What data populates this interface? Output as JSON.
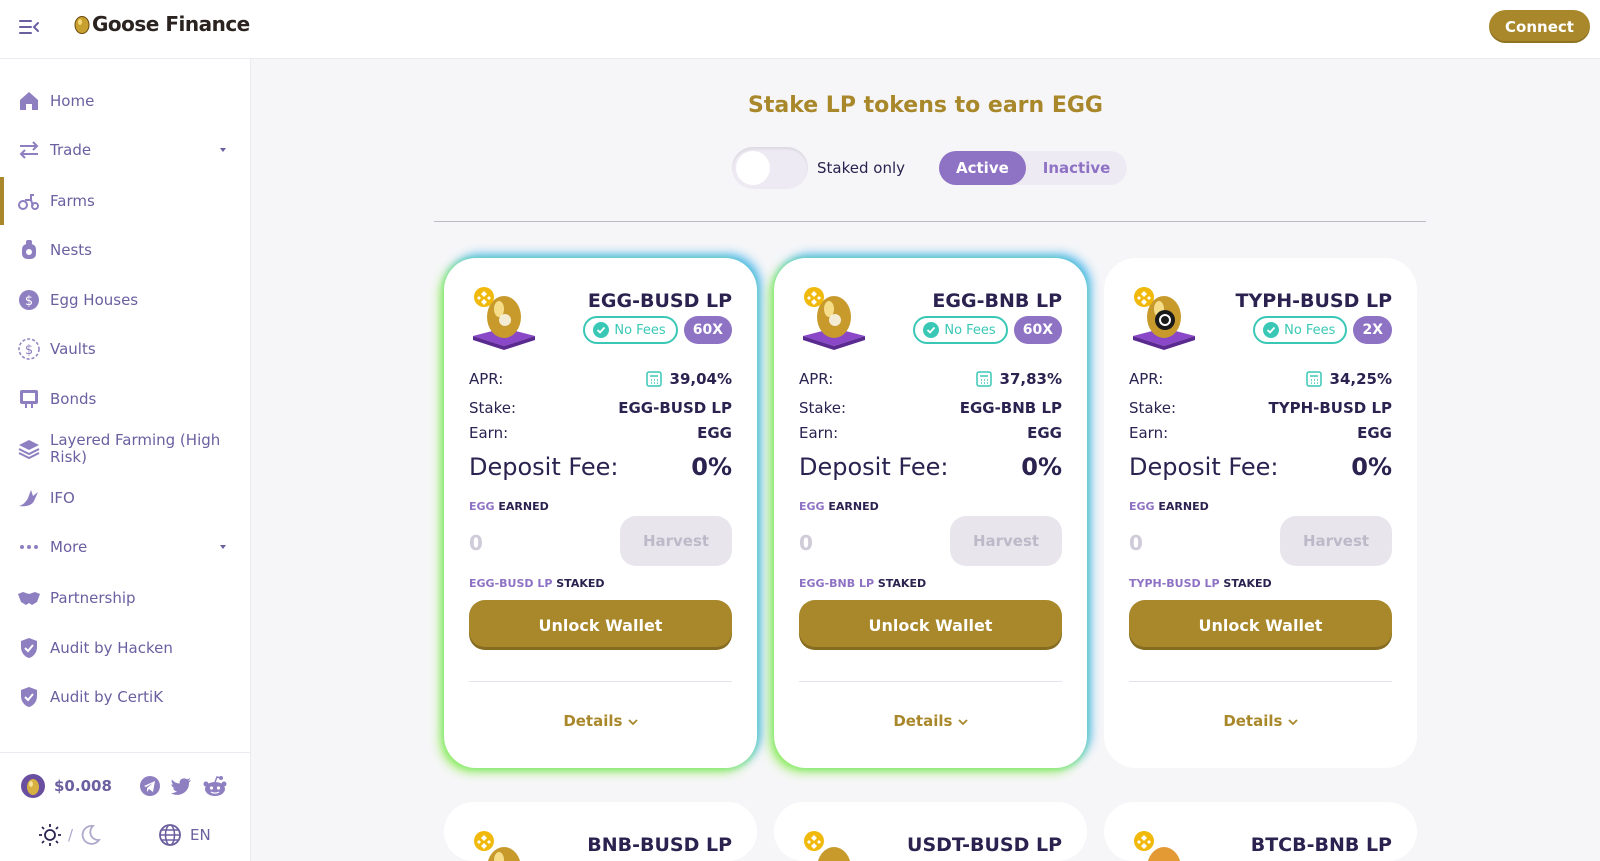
{
  "header": {
    "brand": "Goose Finance",
    "connect_label": "Connect"
  },
  "sidebar": {
    "items": [
      {
        "label": "Home",
        "icon": "home-icon"
      },
      {
        "label": "Trade",
        "icon": "trade-icon",
        "expandable": true
      },
      {
        "label": "Farms",
        "icon": "farms-icon",
        "active": true
      },
      {
        "label": "Nests",
        "icon": "nests-icon"
      },
      {
        "label": "Egg Houses",
        "icon": "egg-houses-icon"
      },
      {
        "label": "Vaults",
        "icon": "vaults-icon"
      },
      {
        "label": "Bonds",
        "icon": "bonds-icon"
      },
      {
        "label": "Layered Farming (High Risk)",
        "icon": "layered-farming-icon"
      },
      {
        "label": "IFO",
        "icon": "ifo-icon"
      },
      {
        "label": "More",
        "icon": "more-icon",
        "expandable": true
      },
      {
        "label": "Partnership",
        "icon": "partnership-icon"
      },
      {
        "label": "Audit by Hacken",
        "icon": "shield-icon"
      },
      {
        "label": "Audit by CertiK",
        "icon": "shield-icon"
      }
    ],
    "footer": {
      "price": "$0.008",
      "theme_separator": "/",
      "language": "EN"
    }
  },
  "main": {
    "title": "Stake LP tokens to earn EGG",
    "staked_only_label": "Staked only",
    "tabs": [
      {
        "label": "Active",
        "selected": true
      },
      {
        "label": "Inactive",
        "selected": false
      }
    ],
    "labels": {
      "apr": "APR:",
      "stake": "Stake:",
      "earn": "Earn:",
      "deposit_fee": "Deposit Fee:",
      "egg_earned_token": "EGG",
      "egg_earned_suffix": " EARNED",
      "staked_suffix": " STAKED",
      "no_fees": "No Fees",
      "harvest": "Harvest",
      "unlock_wallet": "Unlock Wallet",
      "details": "Details"
    },
    "farms": [
      {
        "name": "EGG-BUSD LP",
        "multiplier": "60X",
        "apr": "39,04%",
        "stake": "EGG-BUSD LP",
        "earn": "EGG",
        "deposit_fee": "0%",
        "earned": "0",
        "staked_token": "EGG-BUSD LP",
        "core": "gold"
      },
      {
        "name": "EGG-BNB LP",
        "multiplier": "60X",
        "apr": "37,83%",
        "stake": "EGG-BNB LP",
        "earn": "EGG",
        "deposit_fee": "0%",
        "earned": "0",
        "staked_token": "EGG-BNB LP",
        "core": "gold"
      },
      {
        "name": "TYPH-BUSD LP",
        "multiplier": "2X",
        "apr": "34,25%",
        "stake": "TYPH-BUSD LP",
        "earn": "EGG",
        "deposit_fee": "0%",
        "earned": "0",
        "staked_token": "TYPH-BUSD LP",
        "core": "typh"
      },
      {
        "name": "BNB-BUSD LP"
      },
      {
        "name": "USDT-BUSD LP"
      },
      {
        "name": "BTCB-BNB LP"
      }
    ]
  },
  "colors": {
    "accent_gold": "#a8882a",
    "accent_purple": "#8e72c4",
    "no_fees_teal": "#3ac8b6",
    "text_dark": "#2b2250"
  }
}
